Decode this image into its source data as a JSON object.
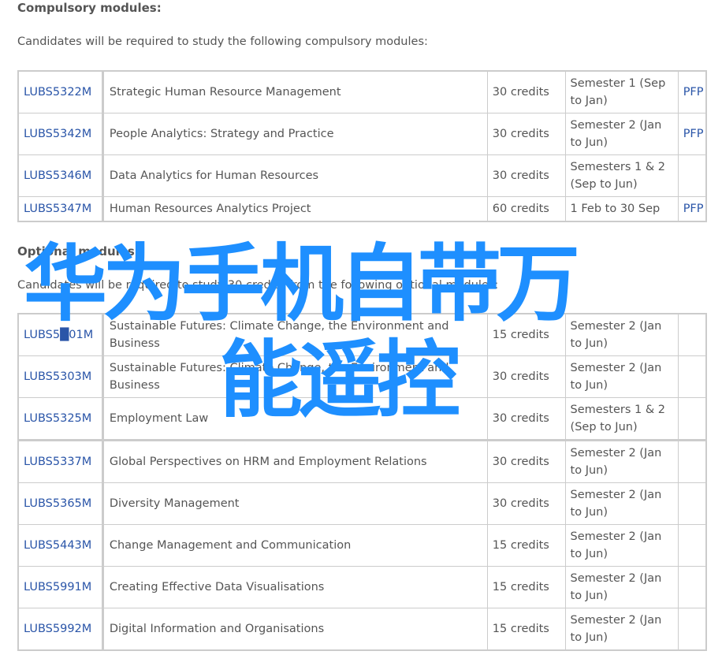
{
  "compulsory": {
    "heading": "Compulsory modules:",
    "intro": "Candidates will be required to study the following compulsory modules:",
    "rows": [
      {
        "code": "LUBS5322M",
        "title": "Strategic Human Resource Management",
        "credits": "30 credits",
        "semester": "Semester 1 (Sep to Jan)",
        "pfp": "PFP"
      },
      {
        "code": "LUBS5342M",
        "title": "People Analytics: Strategy and Practice",
        "credits": "30 credits",
        "semester": "Semester 2 (Jan to Jun)",
        "pfp": "PFP"
      },
      {
        "code": "LUBS5346M",
        "title": "Data Analytics for Human Resources",
        "credits": "30 credits",
        "semester": "Semesters 1 & 2 (Sep to Jun)",
        "pfp": ""
      },
      {
        "code": "LUBS5347M",
        "title": "Human Resources Analytics Project",
        "credits": "60 credits",
        "semester": "1 Feb to 30 Sep",
        "pfp": "PFP"
      }
    ]
  },
  "optional": {
    "heading": "Optional modules:",
    "intro": "Candidates will be required to study 30 credits from the following optional modules:",
    "rows": [
      {
        "code": "LUBS5█01M",
        "title": "Sustainable Futures: Climate Change, the Environment and Business",
        "credits": "15 credits",
        "semester": "Semester 2 (Jan to Jun)",
        "pfp": ""
      },
      {
        "code": "LUBS5303M",
        "title": "Sustainable Futures: Climate Change, the Environment and Business",
        "credits": "30 credits",
        "semester": "Semester 2 (Jan to Jun)",
        "pfp": ""
      },
      {
        "code": "LUBS5325M",
        "title": "Employment Law",
        "credits": "30 credits",
        "semester": "Semesters 1 & 2 (Sep to Jun)",
        "pfp": ""
      },
      {
        "code": "LUBS5337M",
        "title": "Global Perspectives on HRM and Employment Relations",
        "credits": "30 credits",
        "semester": "Semester 2 (Jan to Jun)",
        "pfp": ""
      },
      {
        "code": "LUBS5365M",
        "title": "Diversity Management",
        "credits": "30 credits",
        "semester": "Semester 2 (Jan to Jun)",
        "pfp": ""
      },
      {
        "code": "LUBS5443M",
        "title": "Change Management and Communication",
        "credits": "15 credits",
        "semester": "Semester 2 (Jan to Jun)",
        "pfp": ""
      },
      {
        "code": "LUBS5991M",
        "title": "Creating Effective Data Visualisations",
        "credits": "15 credits",
        "semester": "Semester 2 (Jan to Jun)",
        "pfp": ""
      },
      {
        "code": "LUBS5992M",
        "title": "Digital Information and Organisations",
        "credits": "15 credits",
        "semester": "Semester 2 (Jan to Jun)",
        "pfp": ""
      }
    ]
  },
  "overlay": {
    "line1": "华为手机自带万",
    "line2": "能遥控",
    "color": "#1e8fff"
  },
  "colors": {
    "link": "#2a55a8",
    "text": "#555555",
    "border": "#cccccc"
  }
}
